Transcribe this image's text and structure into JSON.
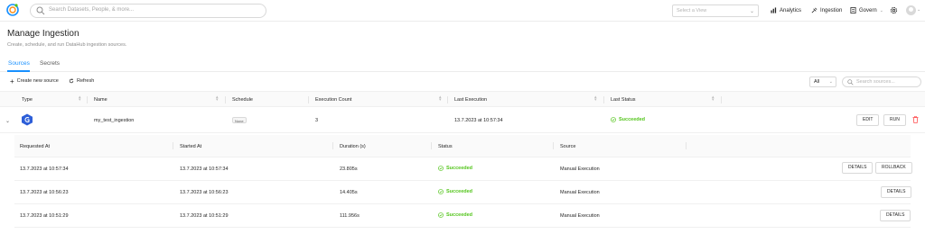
{
  "header": {
    "search_placeholder": "Search Datasets, People, & more...",
    "view_placeholder": "Select a View",
    "nav": {
      "analytics": "Analytics",
      "ingestion": "Ingestion",
      "govern": "Govern"
    }
  },
  "page": {
    "title": "Manage Ingestion",
    "subtitle": "Create, schedule, and run DataHub ingestion sources."
  },
  "tabs": [
    {
      "label": "Sources",
      "active": true
    },
    {
      "label": "Secrets",
      "active": false
    }
  ],
  "toolbar": {
    "create_label": "Create new source",
    "refresh_label": "Refresh",
    "filter_value": "All",
    "search_placeholder": "Search sources..."
  },
  "sources_table": {
    "columns": [
      "Type",
      "Name",
      "Schedule",
      "Execution Count",
      "Last Execution",
      "Last Status"
    ],
    "rows": [
      {
        "type_icon": "glue-icon",
        "name": "my_test_ingestion",
        "schedule": "None",
        "execution_count": "3",
        "last_execution": "13.7.2023 at 10:57:34",
        "last_status": "Succeeded",
        "actions": {
          "edit": "EDIT",
          "run": "RUN"
        }
      }
    ]
  },
  "executions_table": {
    "columns": [
      "Requested At",
      "Started At",
      "Duration (s)",
      "Status",
      "Source"
    ],
    "rows": [
      {
        "requested_at": "13.7.2023 at 10:57:34",
        "started_at": "13.7.2023 at 10:57:34",
        "duration": "23.805s",
        "status": "Succeeded",
        "source": "Manual Execution",
        "details": "DETAILS",
        "rollback": "ROLLBACK"
      },
      {
        "requested_at": "13.7.2023 at 10:56:23",
        "started_at": "13.7.2023 at 10:56:23",
        "duration": "14.405s",
        "status": "Succeeded",
        "source": "Manual Execution",
        "details": "DETAILS"
      },
      {
        "requested_at": "13.7.2023 at 10:51:29",
        "started_at": "13.7.2023 at 10:51:29",
        "duration": "111.956s",
        "status": "Succeeded",
        "source": "Manual Execution",
        "details": "DETAILS"
      }
    ]
  },
  "colors": {
    "accent": "#1890ff",
    "success": "#52c41a",
    "danger": "#ff4d4f"
  }
}
